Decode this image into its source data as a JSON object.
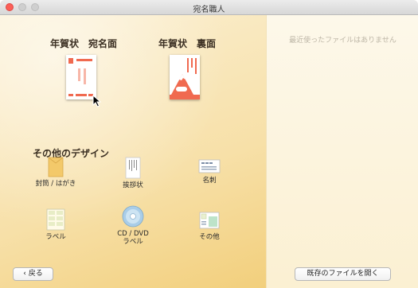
{
  "window": {
    "title": "宛名職人"
  },
  "recent": {
    "empty_text": "最近使ったファイルはありません"
  },
  "templates": [
    {
      "label": "年賀状　宛名面"
    },
    {
      "label": "年賀状　裏面"
    }
  ],
  "other": {
    "title": "その他のデザイン",
    "items": [
      {
        "label": "封筒 / はがき",
        "icon": "envelope-icon"
      },
      {
        "label": "挨拶状",
        "icon": "greeting-card-icon"
      },
      {
        "label": "名刺",
        "icon": "business-card-icon"
      },
      {
        "label": "ラベル",
        "icon": "label-sheet-icon"
      },
      {
        "label_line1": "CD / DVD",
        "label_line2": "ラベル",
        "icon": "disc-icon"
      },
      {
        "label": "その他",
        "icon": "other-design-icon"
      }
    ]
  },
  "buttons": {
    "back": "戻る",
    "back_icon": "chevron-left-icon",
    "open_existing": "既存のファイルを開く"
  },
  "colors": {
    "accent_red": "#f06a50",
    "pane_gold": "#f2cf7c",
    "right_pane": "#fdf8ea"
  }
}
